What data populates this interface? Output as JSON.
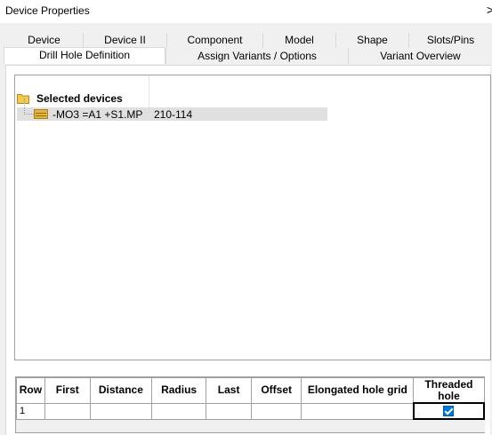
{
  "window": {
    "title": "Device Properties",
    "close_glyph": ">"
  },
  "tabs_back": [
    "Device",
    "Device II",
    "Component",
    "Model",
    "Shape",
    "Slots/Pins"
  ],
  "tabs_front": [
    "Drill Hole Definition",
    "Assign Variants / Options",
    "Variant Overview"
  ],
  "selected_tab": "Drill Hole Definition",
  "tree": {
    "root_label": "Selected devices",
    "rows": [
      {
        "label": "-MO3 =A1 +S1.MP",
        "value": "210-114"
      }
    ]
  },
  "grid": {
    "headers": [
      "Row",
      "First",
      "Distance",
      "Radius",
      "Last",
      "Offset",
      "Elongated hole grid",
      "Threaded hole"
    ],
    "rows": [
      {
        "row": "1",
        "first": "",
        "distance": "",
        "radius": "",
        "last": "",
        "offset": "",
        "elongated": "",
        "threaded": true
      }
    ]
  },
  "colors": {
    "selection": "#e0e0e0",
    "checkbox": "#0078d7",
    "folder": "#f2c94c"
  }
}
